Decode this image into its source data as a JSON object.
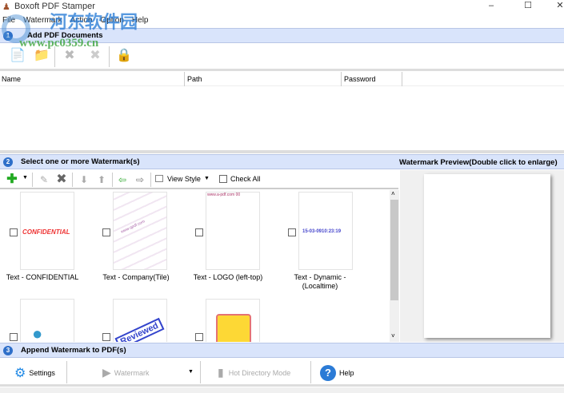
{
  "window": {
    "title": "Boxoft PDF Stamper",
    "minimize": "–",
    "maximize": "☐",
    "close": "✕"
  },
  "menu": [
    "File",
    "Watermark",
    "Action",
    "Option",
    "Help"
  ],
  "section1": {
    "num": "1",
    "title": "Add PDF Documents",
    "columns": [
      "Name",
      "Path",
      "Password"
    ]
  },
  "section2": {
    "num": "2",
    "title": "Select one or more Watermark(s)",
    "preview_title": "Watermark Preview(Double click to enlarge)",
    "view_style": "View Style",
    "check_all": "Check All",
    "items": [
      {
        "label": "Text - CONFIDENTIAL",
        "preview": "CONFIDENTIAL"
      },
      {
        "label": "Text - Company(Tile)",
        "preview": "www.qpdf.com"
      },
      {
        "label": "Text - LOGO (left-top)",
        "preview": "www.a-pdf.com 00"
      },
      {
        "label": "Text - Dynamic - (Localtime)",
        "preview": "15-03-0910:23:19"
      },
      {
        "label": "",
        "preview": ""
      },
      {
        "label": "",
        "preview": "Reviewed"
      },
      {
        "label": "",
        "preview": ""
      }
    ]
  },
  "section3": {
    "num": "3",
    "title": "Append Watermark to PDF(s)",
    "settings": "Settings",
    "watermark": "Watermark",
    "hot_directory": "Hot Directory Mode",
    "help": "Help"
  },
  "site_watermark": {
    "cn": "河东软件园",
    "url": "www.pc0359.cn"
  }
}
